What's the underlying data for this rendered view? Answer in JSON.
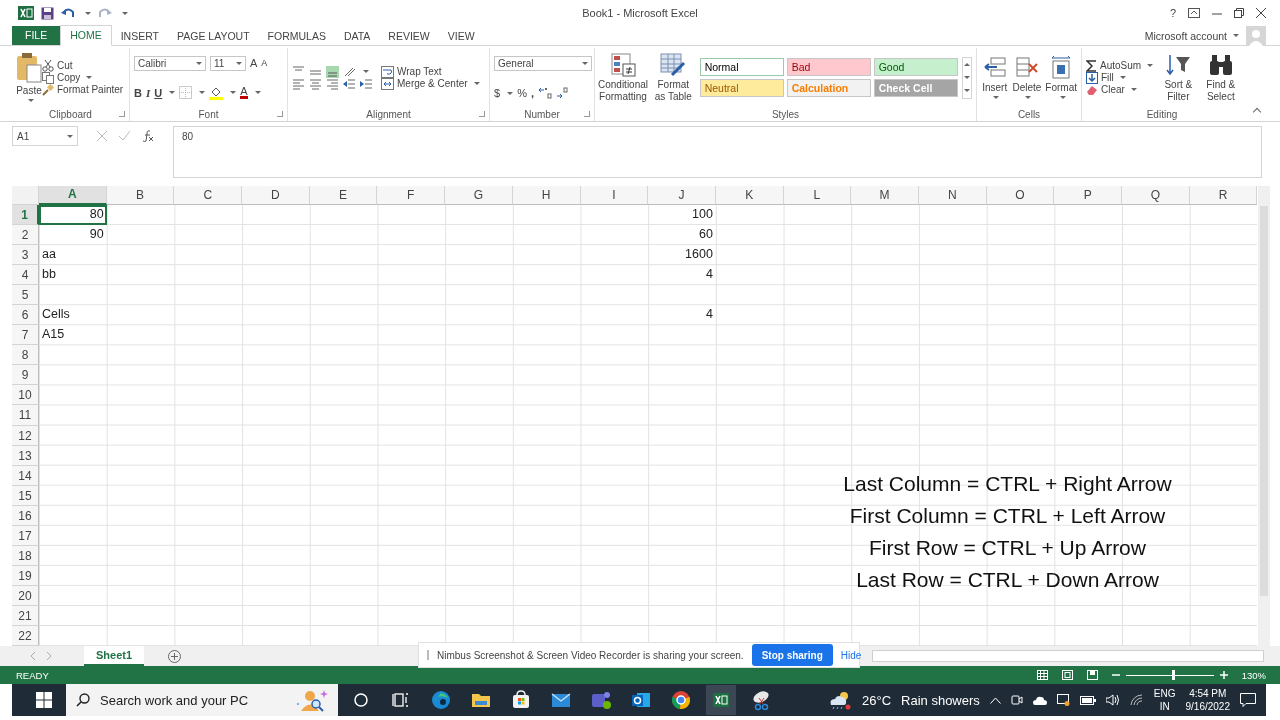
{
  "title_bar": {
    "title": "Book1 - Microsoft Excel",
    "help": "?"
  },
  "tabs": [
    {
      "label": "FILE",
      "kind": "file",
      "selected": false
    },
    {
      "label": "HOME",
      "kind": "tab",
      "selected": true
    },
    {
      "label": "INSERT",
      "kind": "tab",
      "selected": false
    },
    {
      "label": "PAGE LAYOUT",
      "kind": "tab",
      "selected": false
    },
    {
      "label": "FORMULAS",
      "kind": "tab",
      "selected": false
    },
    {
      "label": "DATA",
      "kind": "tab",
      "selected": false
    },
    {
      "label": "REVIEW",
      "kind": "tab",
      "selected": false
    },
    {
      "label": "VIEW",
      "kind": "tab",
      "selected": false
    }
  ],
  "account": "Microsoft account",
  "ribbon": {
    "clipboard": {
      "label": "Clipboard",
      "paste": "Paste",
      "cut": "Cut",
      "copy": "Copy",
      "format_painter": "Format Painter"
    },
    "font": {
      "label": "Font",
      "font_name": "Calibri",
      "font_size": "11",
      "grow": "A",
      "shrink": "A",
      "bold": "B",
      "italic": "I",
      "underline": "U",
      "font_color": "A"
    },
    "alignment": {
      "label": "Alignment",
      "wrap": "Wrap Text",
      "merge": "Merge & Center"
    },
    "number": {
      "label": "Number",
      "format": "General",
      "currency": "$",
      "percent": "%",
      "comma": ","
    },
    "styles": {
      "label": "Styles",
      "conditional": "Conditional Formatting",
      "format_table": "Format as Table",
      "cells": [
        {
          "label": "Normal",
          "kind": "normal",
          "color": "#ffffff",
          "selected": true
        },
        {
          "label": "Bad",
          "kind": "bad",
          "color": "#ffc7ce",
          "selected": false
        },
        {
          "label": "Good",
          "kind": "good",
          "color": "#c6efce",
          "selected": false
        },
        {
          "label": "Neutral",
          "kind": "neutral",
          "color": "#ffeb9c",
          "selected": false
        },
        {
          "label": "Calculation",
          "kind": "calculation",
          "color": "#f2f2f2",
          "selected": false
        },
        {
          "label": "Check Cell",
          "kind": "check",
          "color": "#a5a5a5",
          "selected": false
        }
      ]
    },
    "cells": {
      "label": "Cells",
      "insert": "Insert",
      "delete": "Delete",
      "format": "Format"
    },
    "editing": {
      "label": "Editing",
      "autosum": "AutoSum",
      "fill": "Fill",
      "clear": "Clear",
      "sort": "Sort & Filter",
      "find": "Find & Select"
    }
  },
  "formula_bar": {
    "name_box": "A1",
    "value": "80"
  },
  "sheet": {
    "columns": [
      {
        "label": "A",
        "selected": true
      },
      {
        "label": "B",
        "selected": false
      },
      {
        "label": "C",
        "selected": false
      },
      {
        "label": "D",
        "selected": false
      },
      {
        "label": "E",
        "selected": false
      },
      {
        "label": "F",
        "selected": false
      },
      {
        "label": "G",
        "selected": false
      },
      {
        "label": "H",
        "selected": false
      },
      {
        "label": "I",
        "selected": false
      },
      {
        "label": "J",
        "selected": false
      },
      {
        "label": "K",
        "selected": false
      },
      {
        "label": "L",
        "selected": false
      },
      {
        "label": "M",
        "selected": false
      },
      {
        "label": "N",
        "selected": false
      },
      {
        "label": "O",
        "selected": false
      },
      {
        "label": "P",
        "selected": false
      },
      {
        "label": "Q",
        "selected": false
      },
      {
        "label": "R",
        "selected": false
      }
    ],
    "rows": [
      {
        "label": "1",
        "selected": true,
        "column_a": {
          "value": "80",
          "kind": "number",
          "selected": true
        },
        "column_j": {
          "value": "100",
          "kind": "number",
          "selected": false
        }
      },
      {
        "label": "2",
        "selected": false,
        "column_a": {
          "value": "90",
          "kind": "number",
          "selected": false
        },
        "column_j": {
          "value": "60",
          "kind": "number",
          "selected": false
        }
      },
      {
        "label": "3",
        "selected": false,
        "column_a": {
          "value": "aa",
          "kind": "text",
          "selected": false
        },
        "column_j": {
          "value": "1600",
          "kind": "number",
          "selected": false
        }
      },
      {
        "label": "4",
        "selected": false,
        "column_a": {
          "value": "bb",
          "kind": "text",
          "selected": false
        },
        "column_j": {
          "value": "4",
          "kind": "number",
          "selected": false
        }
      },
      {
        "label": "5",
        "selected": false
      },
      {
        "label": "6",
        "selected": false,
        "column_a": {
          "value": "Cells",
          "kind": "text",
          "selected": false
        },
        "column_j": {
          "value": "4",
          "kind": "number",
          "selected": false
        }
      },
      {
        "label": "7",
        "selected": false,
        "column_a": {
          "value": "A15",
          "kind": "text",
          "selected": false
        }
      },
      {
        "label": "8",
        "selected": false
      },
      {
        "label": "9",
        "selected": false
      },
      {
        "label": "10",
        "selected": false
      },
      {
        "label": "11",
        "selected": false
      },
      {
        "label": "12",
        "selected": false
      },
      {
        "label": "13",
        "selected": false
      },
      {
        "label": "14",
        "selected": false
      },
      {
        "label": "15",
        "selected": false
      },
      {
        "label": "16",
        "selected": false
      },
      {
        "label": "17",
        "selected": false
      },
      {
        "label": "18",
        "selected": false
      },
      {
        "label": "19",
        "selected": false
      },
      {
        "label": "20",
        "selected": false
      },
      {
        "label": "21",
        "selected": false
      },
      {
        "label": "22",
        "selected": false
      }
    ]
  },
  "annotations": [
    "Last Column = CTRL + Right Arrow",
    "First Column = CTRL + Left Arrow",
    "First Row = CTRL + Up Arrow",
    "Last Row = CTRL + Down Arrow"
  ],
  "sheet_tabs": [
    {
      "label": "Sheet1",
      "selected": true
    }
  ],
  "sharing_bar": {
    "message": "Nimbus Screenshot & Screen Video Recorder is sharing your screen.",
    "stop": "Stop sharing",
    "hide": "Hide"
  },
  "status_bar": {
    "status": "READY",
    "zoom": "130%",
    "level": 0.54
  },
  "taskbar": {
    "search_placeholder": "Search work and your PC",
    "temperature": "26°C",
    "weather": "Rain showers",
    "language": "ENG",
    "region": "IN",
    "time": "4:54 PM",
    "date": "9/16/2022"
  }
}
